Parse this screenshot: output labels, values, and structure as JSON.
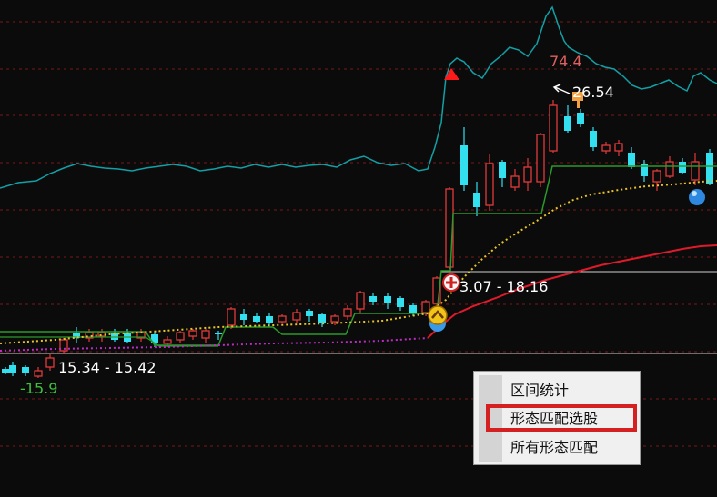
{
  "chart_data": {
    "type": "candlestick",
    "annotations": {
      "low_range": "15.34 - 15.42",
      "high_range": "3.07 - 18.16",
      "peak_value": "26.54",
      "indicator_peak": "74.4",
      "low_value": "-15.9"
    },
    "colors": {
      "up": "#e23a3a",
      "down": "#33e0f0",
      "indicator": "#12a0a6",
      "ma_yellow": "#e8c22a",
      "ma_magenta": "#c02ac8",
      "ma_red": "#e01a2a",
      "step_green": "#2a9a2a"
    }
  },
  "context_menu": {
    "items": [
      {
        "label": "区间统计"
      },
      {
        "label": "形态匹配选股"
      },
      {
        "label": "所有形态匹配"
      }
    ],
    "highlighted_index": 1
  }
}
